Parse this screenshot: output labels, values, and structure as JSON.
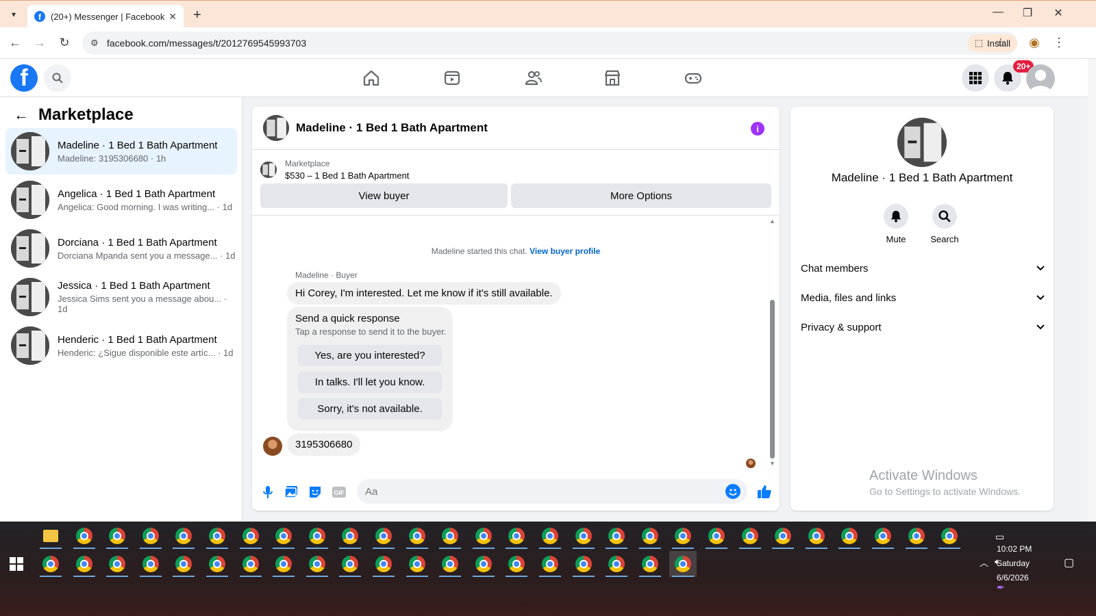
{
  "browser": {
    "tab_title": "(20+) Messenger | Facebook",
    "url": "facebook.com/messages/t/2012769545993703",
    "install_label": "Install"
  },
  "fbnav": {
    "notif_count": "20+"
  },
  "sidebar": {
    "title": "Marketplace",
    "conversations": [
      {
        "name": "Madeline · 1 Bed 1 Bath Apartment",
        "preview": "Madeline: 3195306680 · 1h",
        "active": true
      },
      {
        "name": "Angelica · 1 Bed 1 Bath Apartment",
        "preview": "Angelica: Good morning. I was writing... · 1d"
      },
      {
        "name": "Dorciana · 1 Bed 1 Bath Apartment",
        "preview": "Dorciana Mpanda sent you a message... · 1d"
      },
      {
        "name": "Jessica · 1 Bed 1 Bath Apartment",
        "preview": "Jessica Sims sent you a message abou... · 1d"
      },
      {
        "name": "Henderic · 1 Bed 1 Bath Apartment",
        "preview": "Henderic: ¿Sigue disponible este artíc... · 1d"
      }
    ]
  },
  "chat": {
    "title": "Madeline · 1 Bed 1 Bath Apartment",
    "marketplace_label": "Marketplace",
    "listing": "$530 – 1 Bed 1 Bath Apartment",
    "view_buyer": "View buyer",
    "more_options": "More Options",
    "system_text": "Madeline started this chat.",
    "system_link": "View buyer profile",
    "sender_label": "Madeline · Buyer",
    "first_message": "Hi Corey, I'm interested. Let me know if it's still available.",
    "quick_title": "Send a quick response",
    "quick_sub": "Tap a response to send it to the buyer.",
    "quick_options": [
      "Yes, are you interested?",
      "In talks. I'll let you know.",
      "Sorry, it's not available."
    ],
    "last_message": "3195306680",
    "composer_placeholder": "Aa"
  },
  "rpanel": {
    "name": "Madeline · 1 Bed 1 Bath Apartment",
    "mute": "Mute",
    "search": "Search",
    "rows": [
      "Chat members",
      "Media, files and links",
      "Privacy & support"
    ]
  },
  "watermark": {
    "title": "Activate Windows",
    "sub": "Go to Settings to activate Windows."
  },
  "taskbar": {
    "time": "10:02 PM",
    "day": "Saturday",
    "date": "6/6/2026"
  },
  "colors": {
    "brand": "#1877f2",
    "active_conv": "#e7f3ff",
    "info_purple": "#a033ff"
  }
}
